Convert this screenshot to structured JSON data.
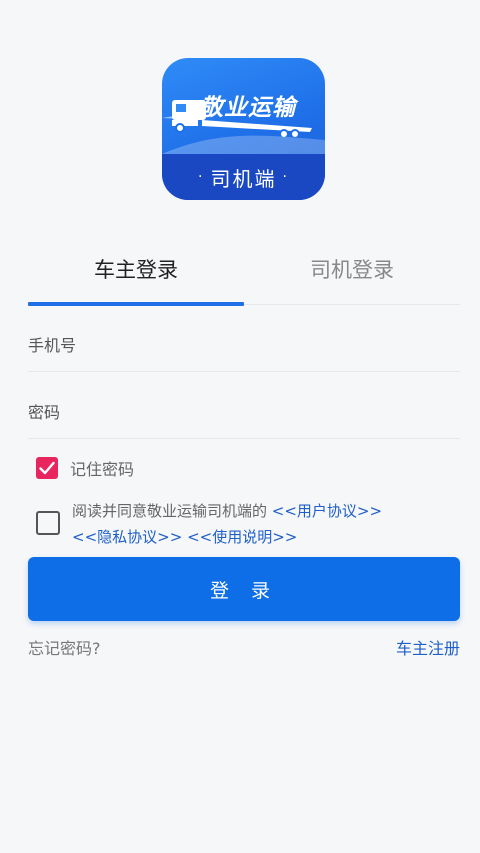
{
  "logo": {
    "title": "敬业运输",
    "subtitle": "司机端",
    "dot": "·"
  },
  "tabs": [
    {
      "label": "车主登录",
      "active": true
    },
    {
      "label": "司机登录",
      "active": false
    }
  ],
  "form": {
    "phone_placeholder": "手机号",
    "phone_value": "",
    "password_placeholder": "密码",
    "password_value": "",
    "remember_label": "记住密码",
    "remember_checked": true,
    "agreement_checked": false,
    "agreement_text": "阅读并同意敬业运输司机端的",
    "user_agreement": "<<用户协议>>",
    "privacy_agreement": "<<隐私协议>>",
    "usage_guide": "<<使用说明>>"
  },
  "login_button": "登 录",
  "forgot_password": "忘记密码?",
  "owner_register": "车主注册",
  "colors": {
    "primary": "#0d6ee8",
    "checkbox": "#e8255f",
    "link": "#1f5fc9",
    "background": "#f6f7f9"
  }
}
